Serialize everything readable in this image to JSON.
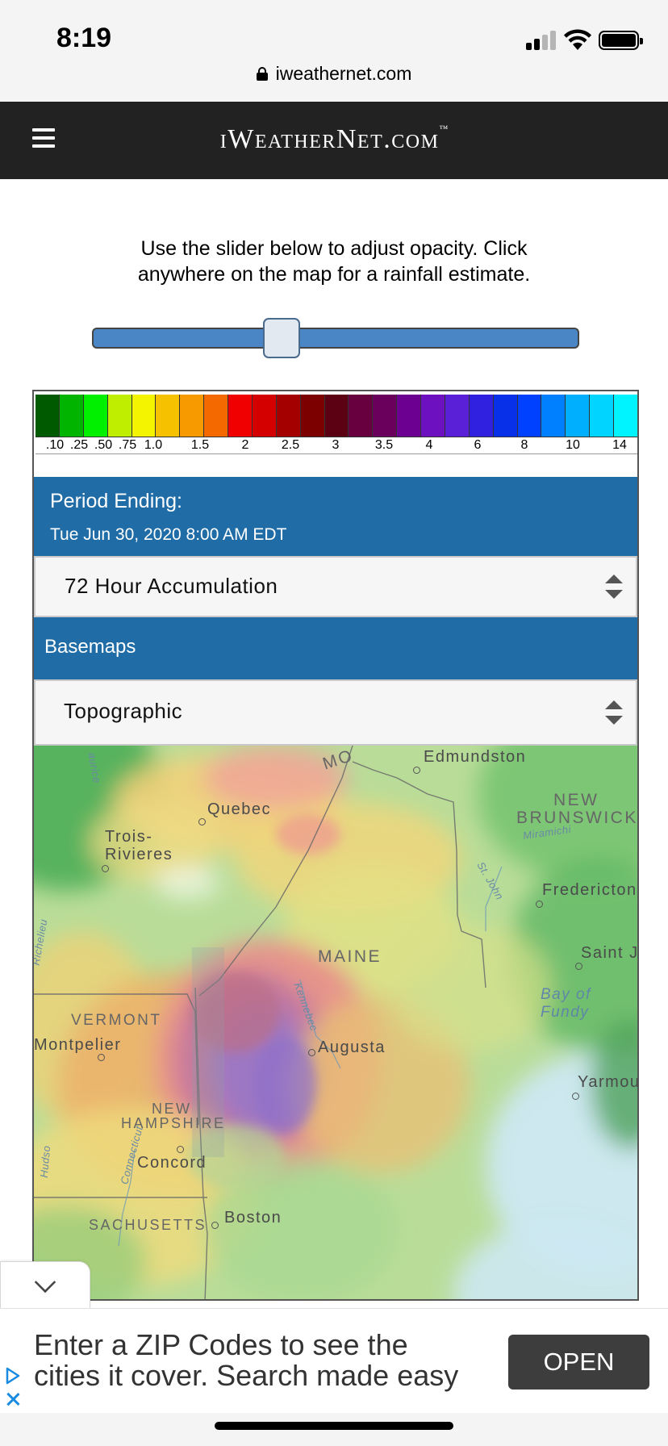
{
  "status_bar": {
    "time": "8:19",
    "url": "iweathernet.com",
    "icons": [
      "lock-icon",
      "signal-icon",
      "wifi-icon",
      "battery-icon"
    ]
  },
  "header": {
    "logo_main": "iWeatherNet.com",
    "logo_tm": "™",
    "menu_icon": "hamburger-icon"
  },
  "intro": {
    "text_line1": "Use the slider below to adjust opacity. Click",
    "text_line2": "anywhere on the map for a rainfall estimate."
  },
  "opacity_slider": {
    "value": 0.38
  },
  "legend": {
    "colors": [
      "#005a00",
      "#00b400",
      "#00f000",
      "#c0ee00",
      "#f4f400",
      "#f6c200",
      "#f69a00",
      "#f46a00",
      "#f00000",
      "#d40000",
      "#a40000",
      "#7c0000",
      "#5c0014",
      "#680040",
      "#6a005c",
      "#6c0090",
      "#6c10c0",
      "#5a20d8",
      "#3020e0",
      "#0830e8",
      "#0040ff",
      "#0080ff",
      "#00b0ff",
      "#00d4ff",
      "#00f4ff"
    ],
    "labels": [
      ".10",
      ".25",
      ".50",
      ".75",
      "1.0",
      "1.5",
      "2",
      "2.5",
      "3",
      "3.5",
      "4",
      "6",
      "8",
      "10",
      "14"
    ]
  },
  "period": {
    "title": "Period Ending:",
    "date": "Tue Jun 30, 2020 8:00 AM EDT"
  },
  "accumulation_select": {
    "selected": "72 Hour Accumulation"
  },
  "basemaps": {
    "title": "Basemaps",
    "selected": "Topographic"
  },
  "map": {
    "cities": [
      "Edmundston",
      "Quebec",
      "Trois-",
      "Rivieres",
      "Fredericton",
      "Saint J",
      "Augusta",
      "Montpelier",
      "Yarmou",
      "Concord",
      "Boston"
    ],
    "regions": [
      "NEW",
      "BRUNSWICK",
      "MAINE",
      "VERMONT",
      "NEW",
      "HAMPSHIRE",
      "SACHUSETTS",
      "MO"
    ],
    "water": [
      "Bay of",
      "Fundy"
    ],
    "rivers": [
      "Miramichi",
      "St. John",
      "Kennebec",
      "Connecticut",
      "Richelieu",
      "aurice",
      "Hudso"
    ]
  },
  "ad": {
    "text_line1": "Enter a ZIP Codes to see the",
    "text_line2": "cities it cover. Search made easy",
    "button": "OPEN"
  }
}
